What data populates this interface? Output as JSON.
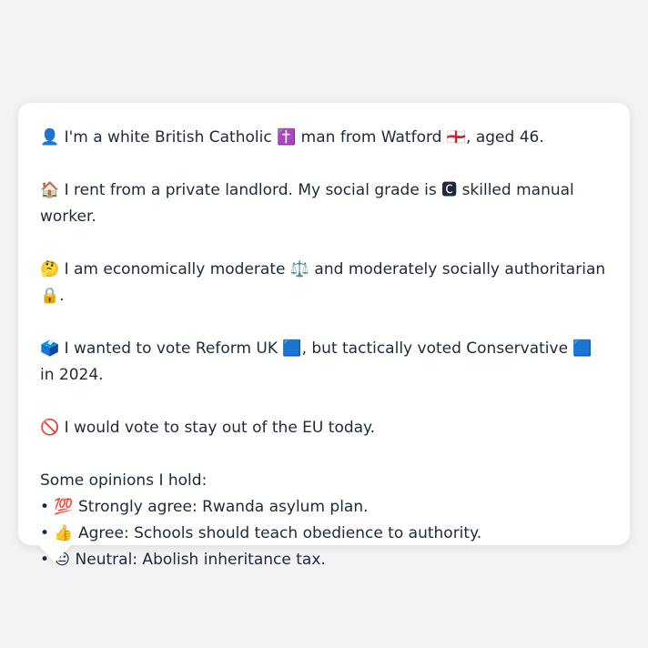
{
  "profile": {
    "identity": "👤 I'm a white British Catholic ✝️ man from Watford 🏴󠁧󠁢󠁥󠁮󠁧󠁿, aged 46.",
    "housing": "🏠 I rent from a private landlord. My social grade is 🅲 skilled manual worker.",
    "politics": "🤔 I am economically moderate ⚖️ and moderately socially authoritarian 🔒.",
    "vote": "🗳️ I wanted to vote Reform UK 🟦, but tactically voted Conservative 🟦 in 2024.",
    "eu": "🚫 I would vote to stay out of the EU today.",
    "opinions_heading": "Some opinions I hold:",
    "opinions": [
      "• 💯 Strongly agree: Rwanda asylum plan.",
      "• 👍 Agree: Schools should teach obedience to authority.",
      "• 😐 Neutral: Abolish inheritance tax."
    ]
  },
  "colors": {
    "page_background": "#f2f3f5",
    "bubble_background": "#ffffff",
    "text": "#1f2937"
  }
}
